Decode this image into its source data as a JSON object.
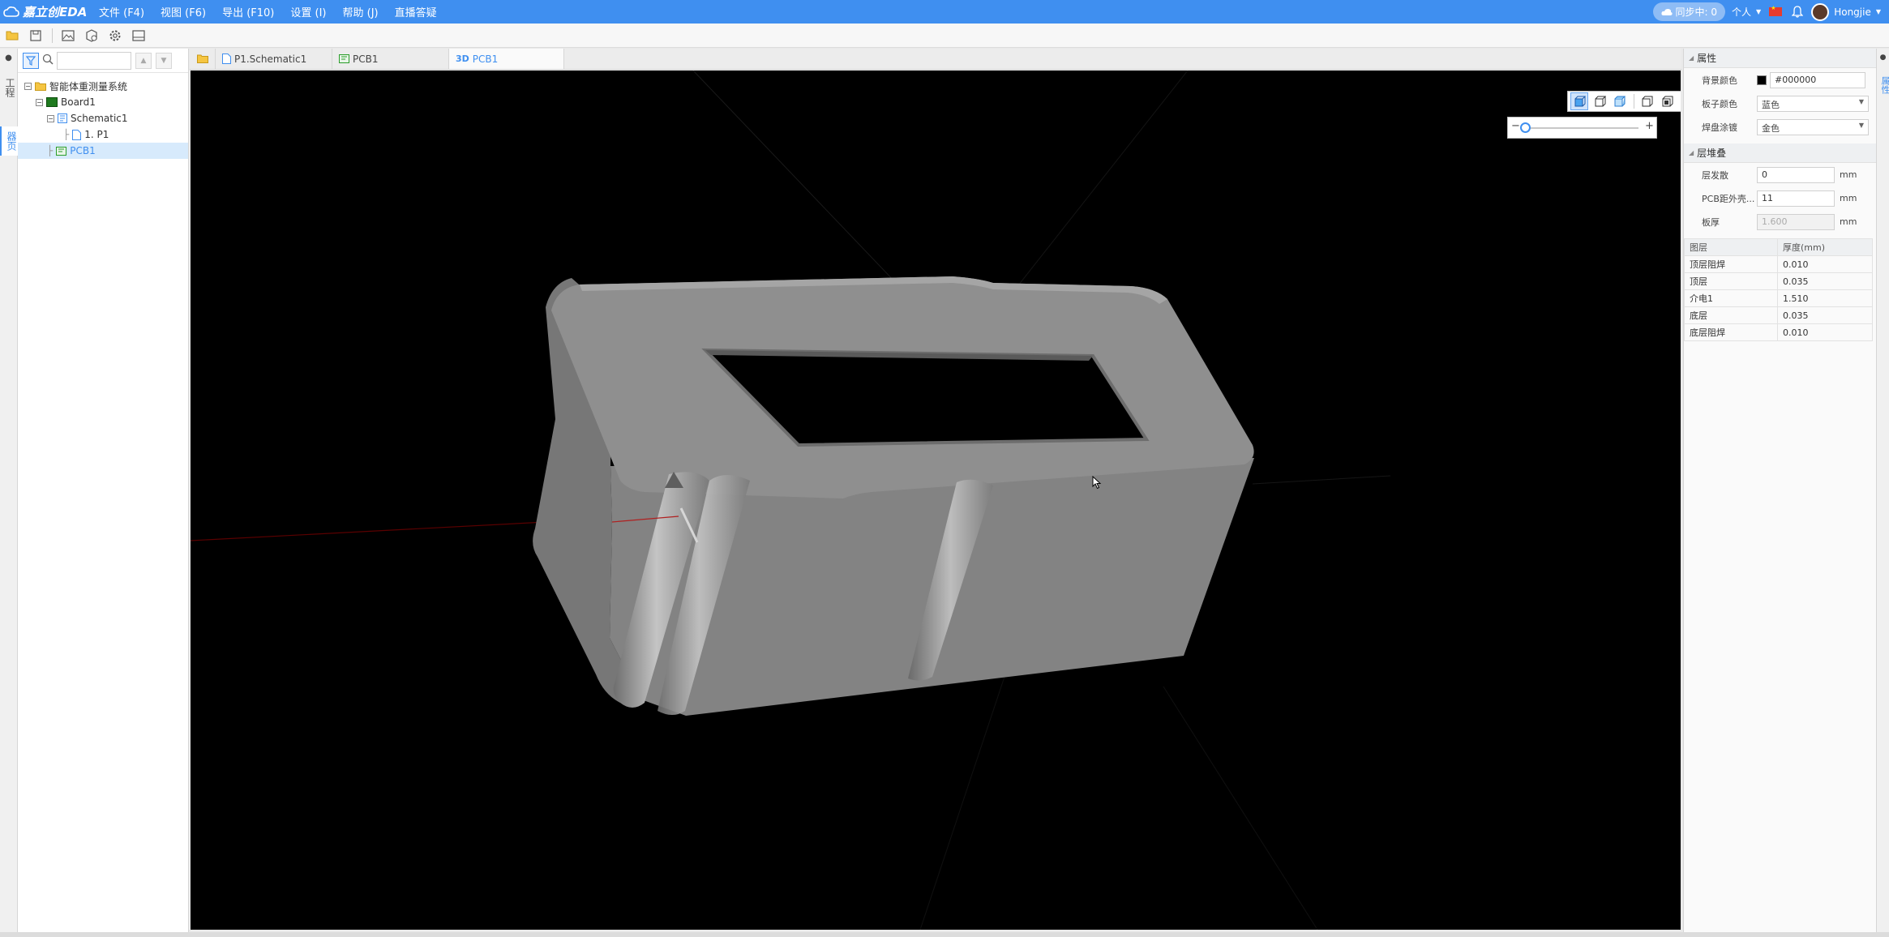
{
  "app": {
    "logo_text": "嘉立创EDA",
    "menu": [
      "文件 (F4)",
      "视图 (F6)",
      "导出 (F10)",
      "设置 (I)",
      "帮助 (J)",
      "直播答疑"
    ],
    "sync_status": "同步中: 0",
    "personal": "个人",
    "username": "Hongjie"
  },
  "vertical_tabs": [
    "工程",
    "器页"
  ],
  "project_tree": {
    "search_placeholder": "",
    "items": [
      {
        "label": "智能体重测量系统",
        "level": 0,
        "type": "folder"
      },
      {
        "label": "Board1",
        "level": 1,
        "type": "board"
      },
      {
        "label": "Schematic1",
        "level": 2,
        "type": "schematic"
      },
      {
        "label": "1. P1",
        "level": 3,
        "type": "page"
      },
      {
        "label": "PCB1",
        "level": 2,
        "type": "pcb",
        "selected": true
      }
    ]
  },
  "doc_tabs": [
    {
      "label": "P1.Schematic1",
      "type": "schematic"
    },
    {
      "label": "PCB1",
      "type": "pcb"
    },
    {
      "label": "PCB1",
      "type": "3d",
      "prefix": "3D",
      "active": true
    }
  ],
  "properties": {
    "section_title": "属性",
    "background_color_label": "背景颜色",
    "background_color_value": "#000000",
    "board_color_label": "板子颜色",
    "board_color_value": "蓝色",
    "pad_finish_label": "焊盘涂镀",
    "pad_finish_value": "金色"
  },
  "stackup": {
    "section_title": "层堆叠",
    "spacing_label": "层发散",
    "spacing_value": "0",
    "distance_label": "PCB距外壳...",
    "distance_value": "11",
    "thickness_label": "板厚",
    "thickness_value": "1.600",
    "unit": "mm",
    "table_headers": [
      "图层",
      "厚度(mm)"
    ],
    "table_rows": [
      [
        "顶层阻焊",
        "0.010"
      ],
      [
        "顶层",
        "0.035"
      ],
      [
        "介电1",
        "1.510"
      ],
      [
        "底层",
        "0.035"
      ],
      [
        "底层阻焊",
        "0.010"
      ]
    ]
  },
  "right_strip_tab": "属性",
  "colors": {
    "accent": "#3f8ff0",
    "viewport_bg": "#000000",
    "enclosure": "#8c8c8c"
  }
}
